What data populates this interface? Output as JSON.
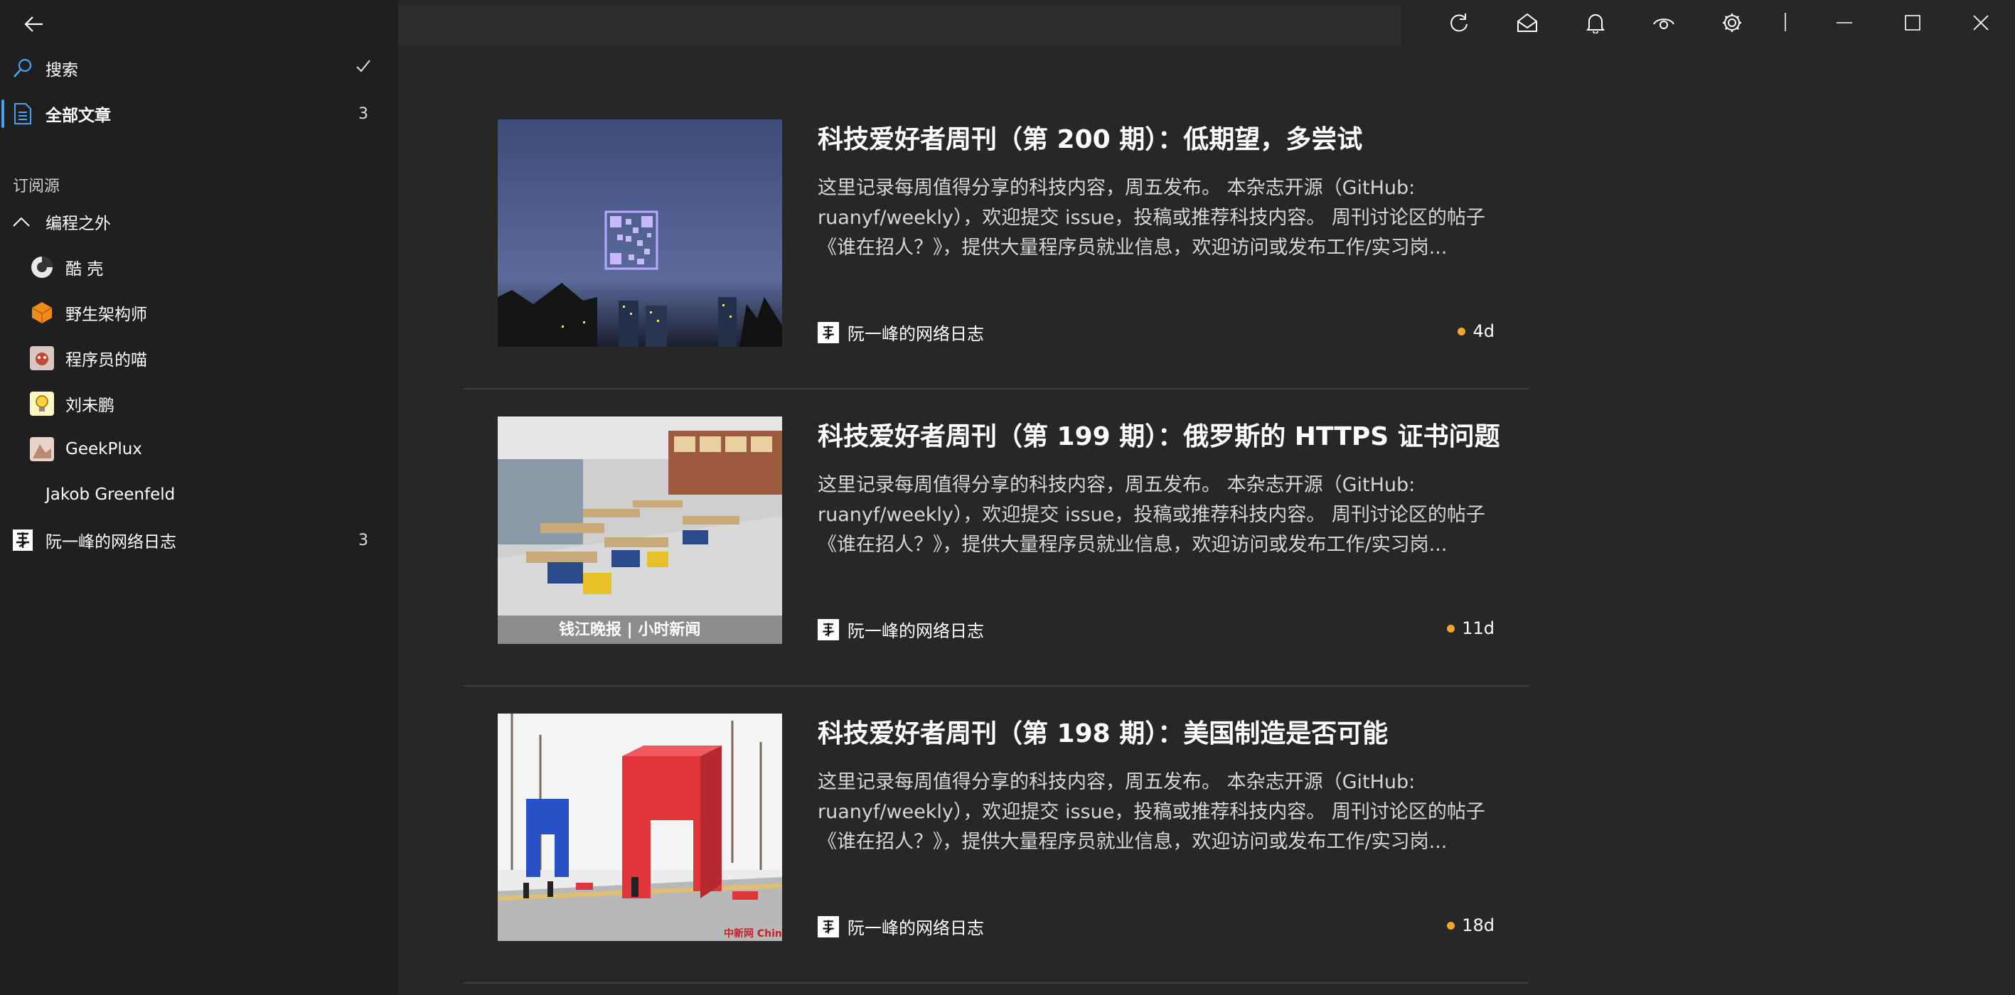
{
  "sidebar": {
    "search_label": "搜索",
    "all_articles": {
      "label": "全部文章",
      "count": "3"
    },
    "section_header": "订阅源",
    "folder": {
      "label": "编程之外"
    },
    "feeds": [
      {
        "label": "酷 壳",
        "icon": "coolshell-icon"
      },
      {
        "label": "野生架构师",
        "icon": "orange-cube-icon"
      },
      {
        "label": "程序员的喵",
        "icon": "cat-avatar-icon"
      },
      {
        "label": "刘未鹏",
        "icon": "lightbulb-icon"
      },
      {
        "label": "GeekPlux",
        "icon": "geekplux-avatar-icon"
      },
      {
        "label": "Jakob Greenfeld",
        "icon": ""
      }
    ],
    "ruanyf": {
      "label": "阮一峰的网络日志",
      "count": "3"
    }
  },
  "articles": [
    {
      "title": "科技爱好者周刊（第 200 期）：低期望，多尝试",
      "summary": [
        "这里记录每周值得分享的科技内容，周五发布。 本杂志开源（GitHub:",
        "ruanyf/weekly），欢迎提交 issue，投稿或推荐科技内容。 周刊讨论区的帖子",
        "《谁在招人？》，提供大量程序员就业信息，欢迎访问或发布工作/实习岗..."
      ],
      "source": "阮一峰的网络日志",
      "time": "4d"
    },
    {
      "title": "科技爱好者周刊（第 199 期）：俄罗斯的 HTTPS 证书问题",
      "summary": [
        "这里记录每周值得分享的科技内容，周五发布。 本杂志开源（GitHub:",
        "ruanyf/weekly），欢迎提交 issue，投稿或推荐科技内容。 周刊讨论区的帖子",
        "《谁在招人？》，提供大量程序员就业信息，欢迎访问或发布工作/实习岗..."
      ],
      "source": "阮一峰的网络日志",
      "time": "11d",
      "thumb_caption": "钱江晚报 | 小时新闻"
    },
    {
      "title": "科技爱好者周刊（第 198 期）：美国制造是否可能",
      "summary": [
        "这里记录每周值得分享的科技内容，周五发布。 本杂志开源（GitHub:",
        "ruanyf/weekly），欢迎提交 issue，投稿或推荐科技内容。 周刊讨论区的帖子",
        "《谁在招人？》，提供大量程序员就业信息，欢迎访问或发布工作/实习岗..."
      ],
      "source": "阮一峰的网络日志",
      "time": "18d",
      "thumb_caption": "中新网 Chinanews"
    }
  ],
  "colors": {
    "accent": "#4aa3f0",
    "unread_dot": "#f4a52a",
    "background": "#272727",
    "sidebar": "#1f1f1f"
  }
}
